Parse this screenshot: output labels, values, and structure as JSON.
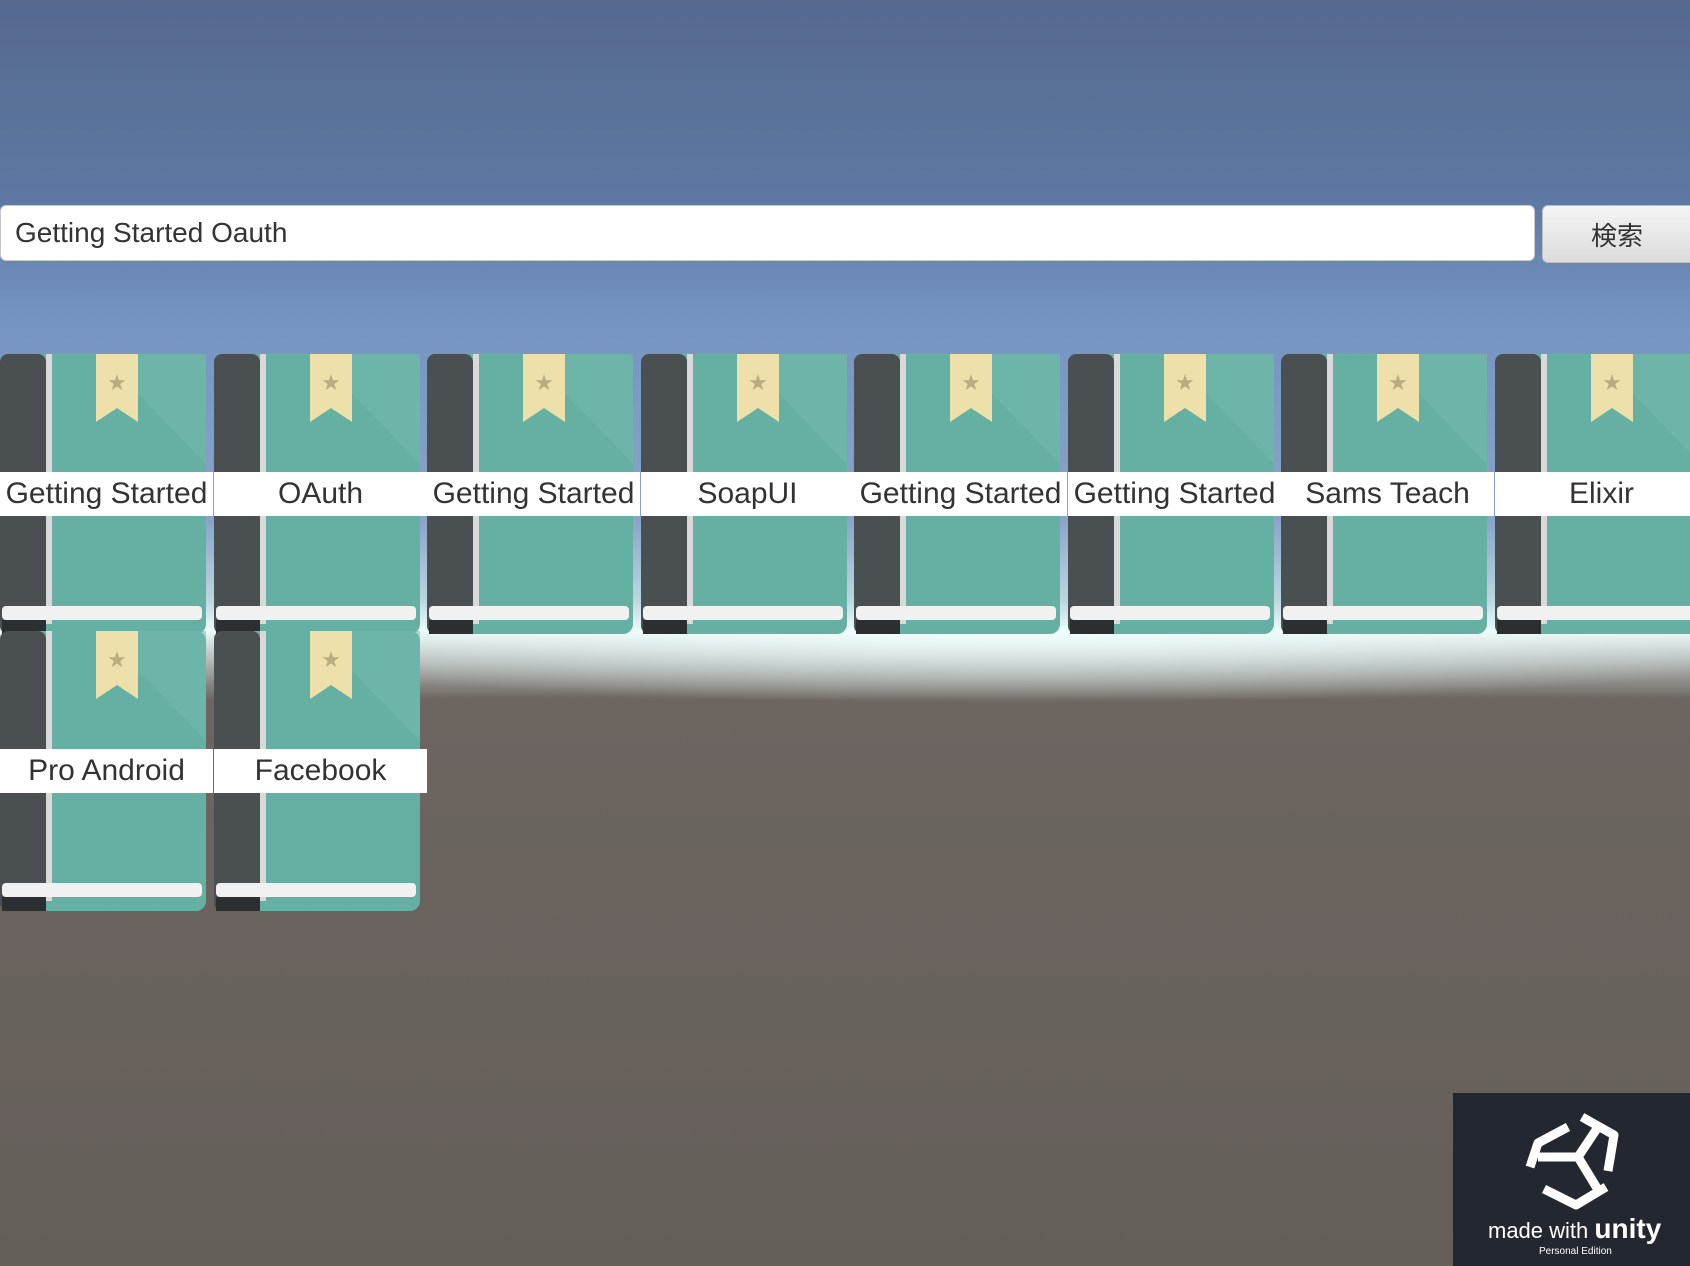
{
  "search": {
    "query": "Getting Started Oauth",
    "button_label": "検索"
  },
  "books": [
    {
      "title": "Getting Started"
    },
    {
      "title": "OAuth"
    },
    {
      "title": "Getting Started"
    },
    {
      "title": "SoapUI"
    },
    {
      "title": "Getting Started"
    },
    {
      "title": "Getting Started"
    },
    {
      "title": "Sams Teach"
    },
    {
      "title": "Elixir"
    },
    {
      "title": "Pro Android"
    },
    {
      "title": "Facebook"
    }
  ],
  "footer": {
    "made_with": "made with",
    "brand": "unity",
    "edition": "Personal Edition"
  },
  "colors": {
    "book_cover": "#66b0a3",
    "book_spine": "#4a4f52",
    "bookmark": "#ede0aa",
    "badge_bg": "#232830"
  },
  "icons": {
    "bookmark": "star-bookmark-icon",
    "logo": "unity-logo-icon"
  }
}
